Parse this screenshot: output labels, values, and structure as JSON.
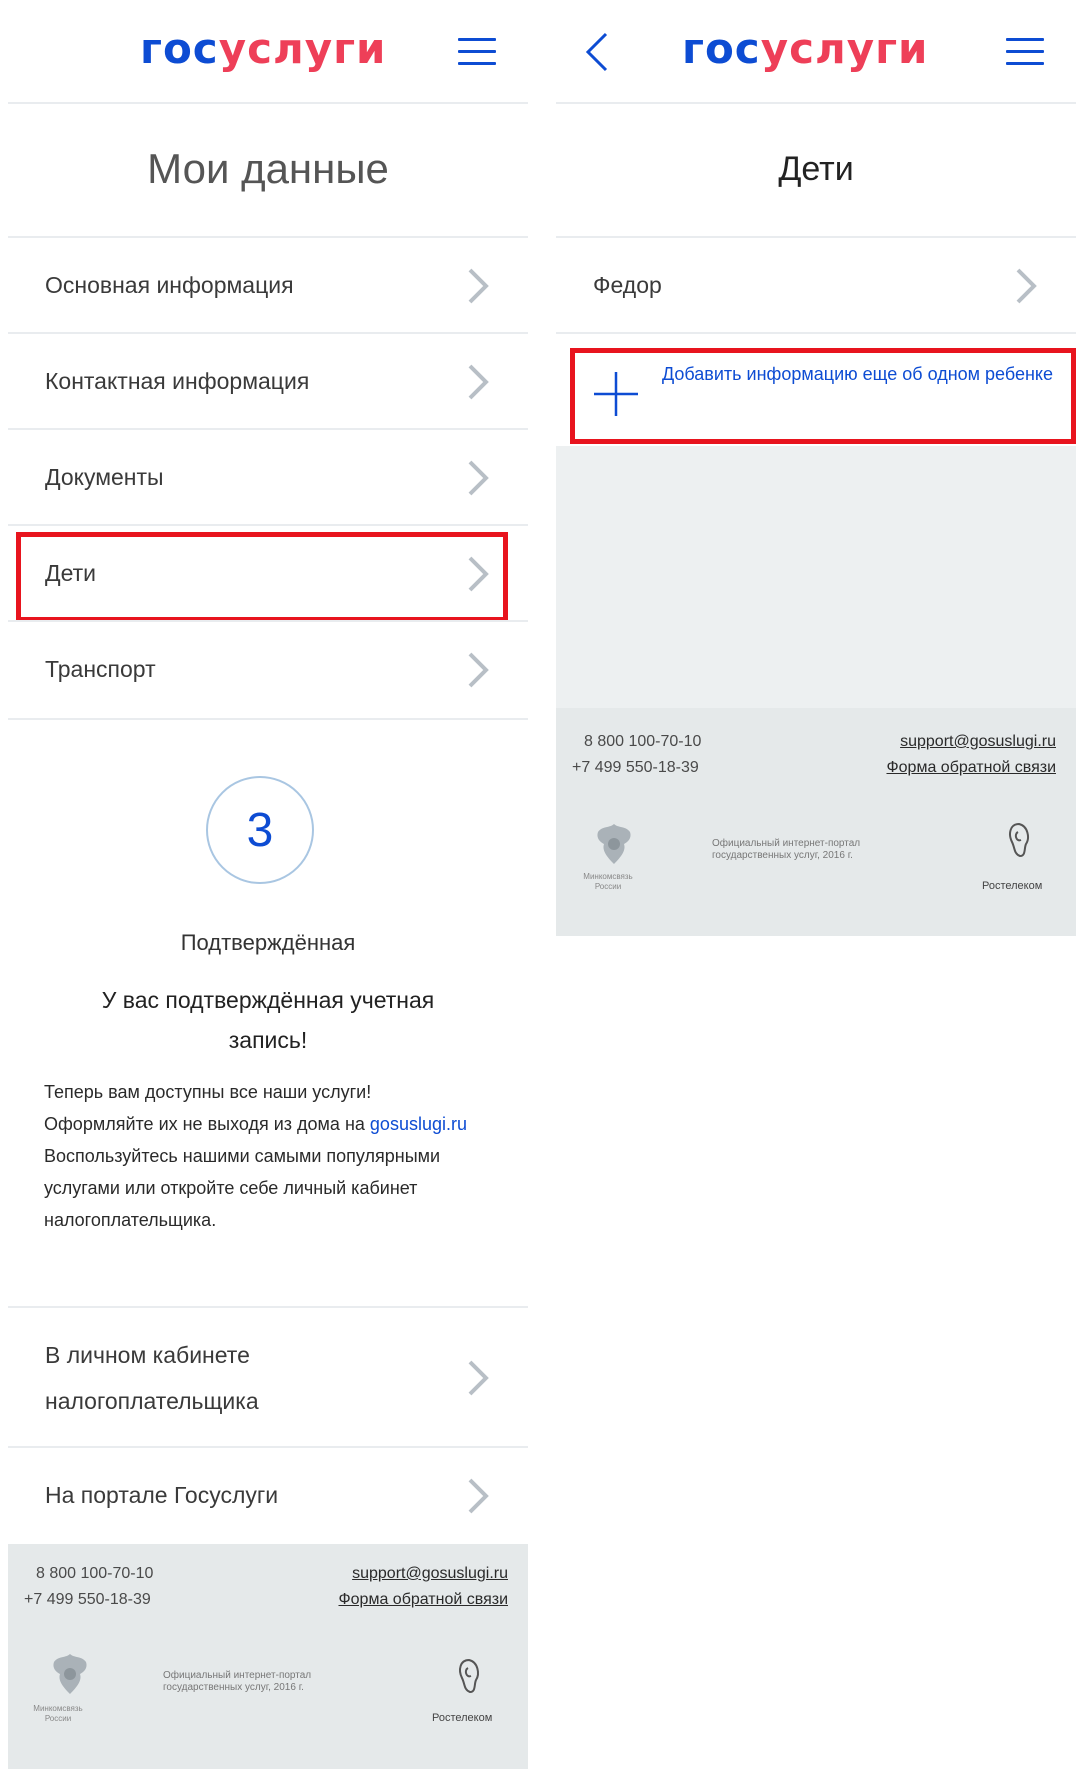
{
  "left": {
    "logo": {
      "part1": "гос",
      "part2": "услуги"
    },
    "title": "Мои данные",
    "menu": [
      {
        "label": "Основная информация"
      },
      {
        "label": "Контактная информация"
      },
      {
        "label": "Документы"
      },
      {
        "label": "Дети"
      },
      {
        "label": "Транспорт"
      }
    ],
    "status": {
      "level": "3",
      "level_name": "Подтверждённая",
      "headline": "У вас подтверждённая учетная запись!",
      "text_before_link": "Теперь вам доступны все наши услуги! Оформляйте их не выходя из дома на",
      "link": "gosuslugi.ru",
      "text_after_link": " Воспользуйтесь нашими самыми популярными услугами или откройте себе личный кабинет налогоплательщика."
    },
    "links": [
      {
        "label": "В личном кабинете налогоплательщика"
      },
      {
        "label": "На портале Госуслуги"
      }
    ]
  },
  "right": {
    "logo": {
      "part1": "гос",
      "part2": "услуги"
    },
    "title": "Дети",
    "child": {
      "name": "Федор"
    },
    "add_child": "Добавить информацию еще об одном ребенке"
  },
  "footer": {
    "phone1": "8 800 100-70-10",
    "phone2": "+7 499 550-18-39",
    "email": "support@gosuslugi.ru",
    "feedback": "Форма обратной связи",
    "portal_line1": "Официальный интернет-портал",
    "portal_line2": "государственных услуг, 2016 г.",
    "ministry_line1": "Минкомсвязь",
    "ministry_line2": "России",
    "operator": "Ростелеком"
  },
  "colors": {
    "brand_blue": "#0d4cd3",
    "brand_red": "#ee3f58",
    "highlight": "#e8141e",
    "footer_bg": "#e5e9ea"
  }
}
